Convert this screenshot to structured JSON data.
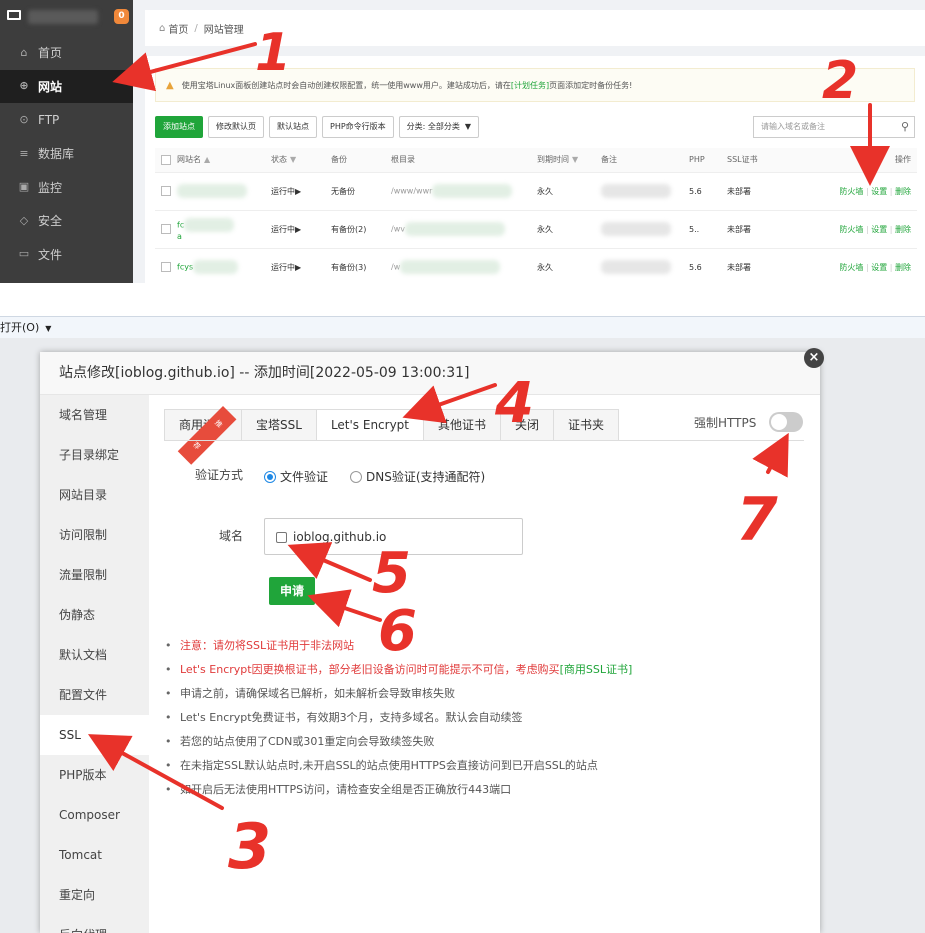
{
  "top": {
    "badge_count": "0",
    "nav": [
      {
        "icon": "home-icon",
        "glyph": "⌂",
        "label": "首页"
      },
      {
        "icon": "globe-icon",
        "glyph": "⊕",
        "label": "网站"
      },
      {
        "icon": "ftp-icon",
        "glyph": "⊙",
        "label": "FTP"
      },
      {
        "icon": "database-icon",
        "glyph": "≡",
        "label": "数据库"
      },
      {
        "icon": "monitor-icon",
        "glyph": "▣",
        "label": "监控"
      },
      {
        "icon": "shield-icon",
        "glyph": "◇",
        "label": "安全"
      },
      {
        "icon": "folder-icon",
        "glyph": "▭",
        "label": "文件"
      }
    ],
    "breadcrumb": {
      "home": "首页",
      "sep": "/",
      "current": "网站管理"
    },
    "warning": {
      "text_before": "使用宝塔Linux面板创建站点时会自动创建权限配置，统一使用www用户。建站成功后，请在",
      "link": "[计划任务]",
      "text_after": "页面添加定时备份任务!"
    },
    "toolbar": {
      "add_site": "添加站点",
      "modify_default_page": "修改默认页",
      "default_site": "默认站点",
      "php_cli": "PHP命令行版本",
      "category": "分类: 全部分类"
    },
    "search_placeholder": "请输入域名或备注",
    "columns": {
      "name": "网站名",
      "status": "状态",
      "backup": "备份",
      "root": "根目录",
      "expire": "到期时间",
      "remark": "备注",
      "php": "PHP",
      "ssl": "SSL证书",
      "ops": "操作"
    },
    "rows": [
      {
        "name": "",
        "status": "运行中▶",
        "backup": "无备份",
        "root": "/www/wwr",
        "expire": "永久",
        "php": "5.6",
        "ssl": "未部署",
        "op_firewall": "防火墙",
        "op_settings": "设置",
        "op_delete": "删除"
      },
      {
        "name": "fc",
        "name2": "a",
        "status": "运行中▶",
        "backup": "有备份(2)",
        "root": "/wv",
        "expire": "永久",
        "php": "5..",
        "ssl": "未部署",
        "op_firewall": "防火墙",
        "op_settings": "设置",
        "op_delete": "删除"
      },
      {
        "name": "fcys",
        "status": "运行中▶",
        "backup": "有备份(3)",
        "root": "/w",
        "expire": "永久",
        "php": "5.6",
        "ssl": "未部署",
        "op_firewall": "防火墙",
        "op_settings": "设置",
        "op_delete": "删除"
      }
    ],
    "op_sep": "|"
  },
  "strip": {
    "label": "打开(O)"
  },
  "dialog": {
    "title": "站点修改[ioblog.github.io] -- 添加时间[2022-05-09 13:00:31]",
    "close": "×",
    "menu": [
      "域名管理",
      "子目录绑定",
      "网站目录",
      "访问限制",
      "流量限制",
      "伪静态",
      "默认文档",
      "配置文件",
      "SSL",
      "PHP版本",
      "Composer",
      "Tomcat",
      "重定向",
      "反向代理"
    ],
    "tabs": [
      "商用证书",
      "宝塔SSL",
      "Let's Encrypt",
      "其他证书",
      "关闭",
      "证书夹"
    ],
    "ribbon": "推荐",
    "force_https": "强制HTTPS",
    "verify_label": "验证方式",
    "verify_file": "文件验证",
    "verify_dns": "DNS验证(支持通配符)",
    "domain_label": "域名",
    "domain_value": "ioblog.github.io",
    "apply": "申请",
    "tips": [
      {
        "text": "注意：请勿将SSL证书用于非法网站",
        "red": true
      },
      {
        "text": "Let's Encrypt因更换根证书，部分老旧设备访问时可能提示不可信，考虑购买",
        "link": "[商用SSL证书]",
        "red": true
      },
      {
        "text": "申请之前，请确保域名已解析，如未解析会导致审核失败"
      },
      {
        "text": "Let's Encrypt免费证书，有效期3个月，支持多域名。默认会自动续签"
      },
      {
        "text": "若您的站点使用了CDN或301重定向会导致续签失败"
      },
      {
        "text": "在未指定SSL默认站点时,未开启SSL的站点使用HTTPS会直接访问到已开启SSL的站点"
      },
      {
        "text": "如开启后无法使用HTTPS访问，请检查安全组是否正确放行443端口"
      }
    ]
  },
  "annotations": [
    "1",
    "2",
    "3",
    "4",
    "5",
    "6",
    "7"
  ],
  "colors": {
    "accent": "#20a53a",
    "annotation": "#e8322a",
    "warn": "#f0883a"
  }
}
